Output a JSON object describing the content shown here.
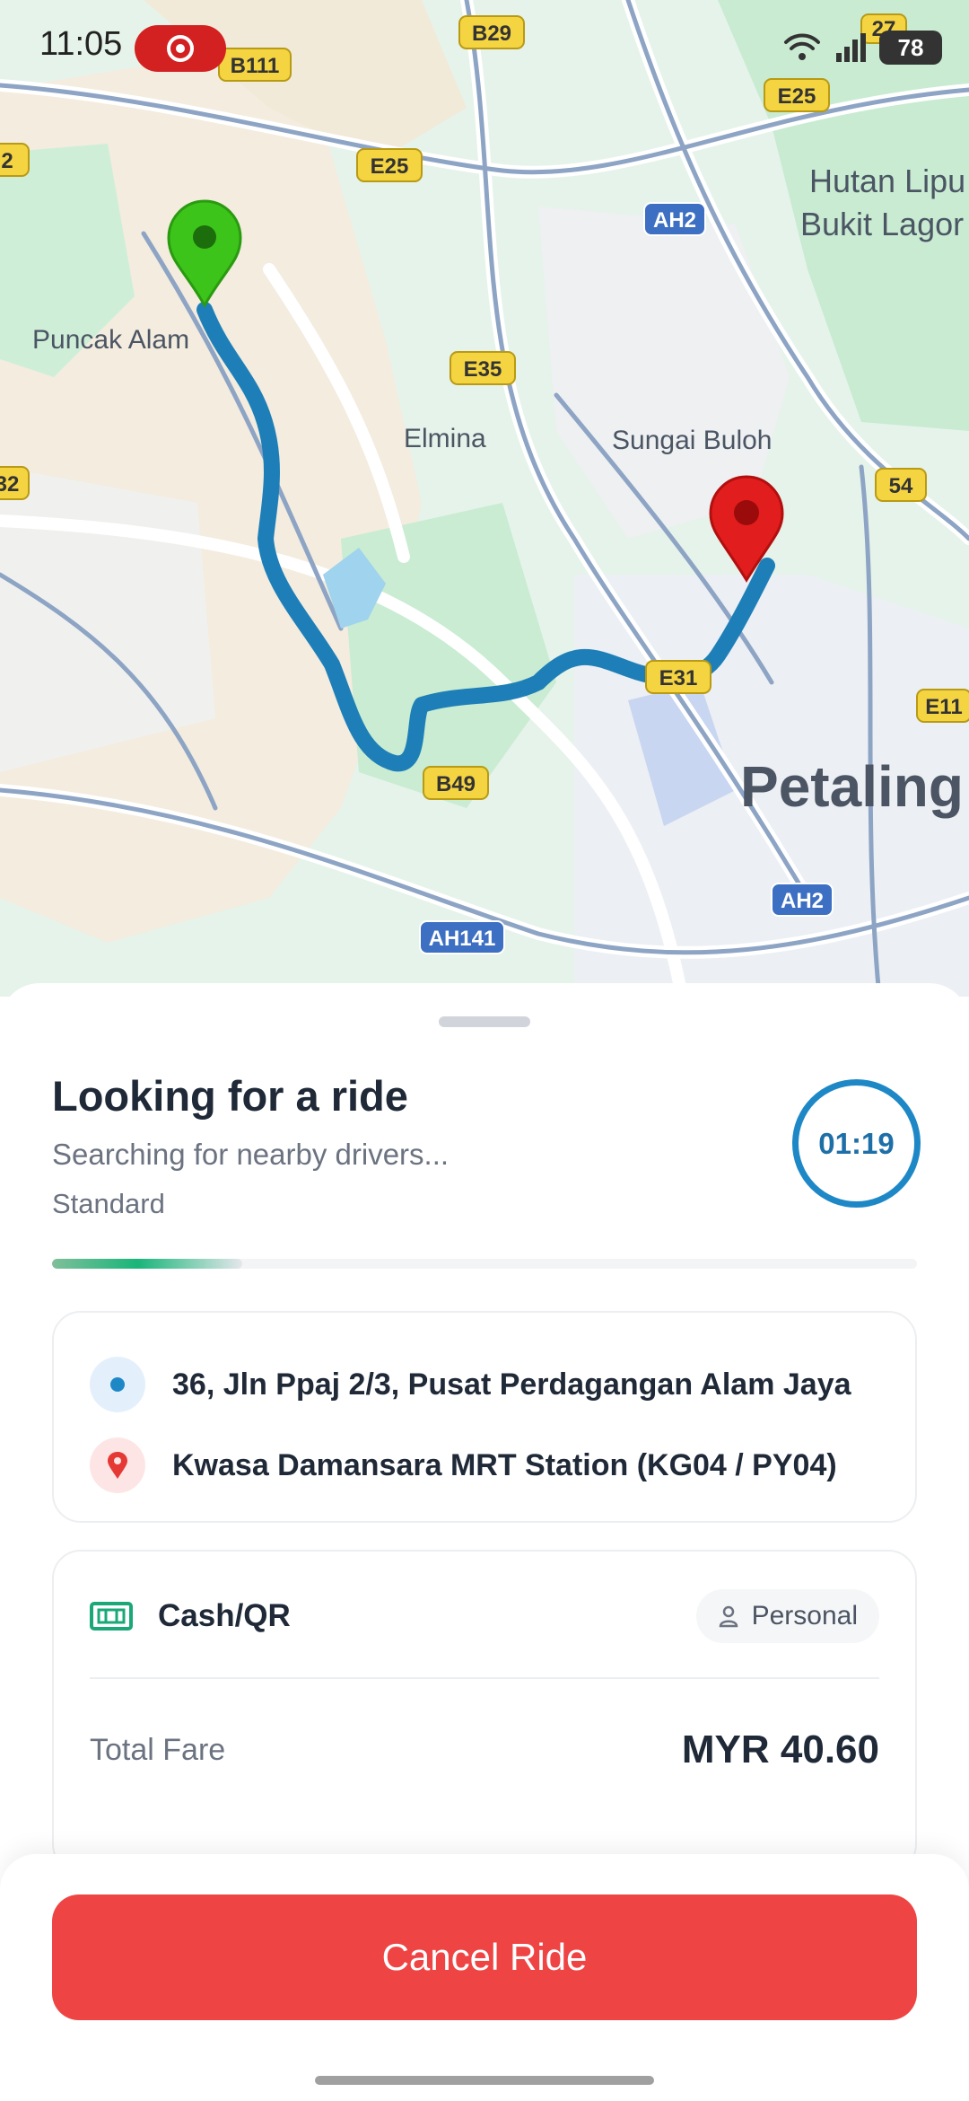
{
  "status_bar": {
    "time": "11:05",
    "battery": "78"
  },
  "map": {
    "places": {
      "puncak_alam": "Puncak Alam",
      "elmina": "Elmina",
      "sungai_buloh": "Sungai Buloh",
      "petaling": "Petaling",
      "hutan_1": "Hutan Lipu",
      "hutan_2": "Bukit Lagor"
    },
    "road_badges": {
      "b29": "B29",
      "b111": "B111",
      "e25a": "E25",
      "e25b": "E25",
      "ah2a": "AH2",
      "e35": "E35",
      "b49": "B49",
      "e31": "E31",
      "ah141": "AH141",
      "ah2b": "AH2",
      "r54": "54",
      "e11": "E11",
      "r27": "27",
      "r2": "2",
      "r32": "32"
    },
    "colors": {
      "route": "#1e7fb8",
      "pickup_pin": "#3cc41a",
      "drop_pin": "#e11d1d"
    }
  },
  "ride": {
    "title": "Looking for a ride",
    "subtitle": "Searching for nearby drivers...",
    "type": "Standard",
    "timer": "01:19",
    "search_progress": 0.22
  },
  "locations": {
    "pickup": "36, Jln Ppaj 2/3, Pusat Perdagangan Alam Jaya",
    "dropoff": "Kwasa Damansara MRT Station (KG04 / PY04)"
  },
  "payment": {
    "method": "Cash/QR",
    "profile": "Personal",
    "fare_label": "Total Fare",
    "fare_value": "MYR 40.60"
  },
  "actions": {
    "cancel": "Cancel Ride"
  }
}
